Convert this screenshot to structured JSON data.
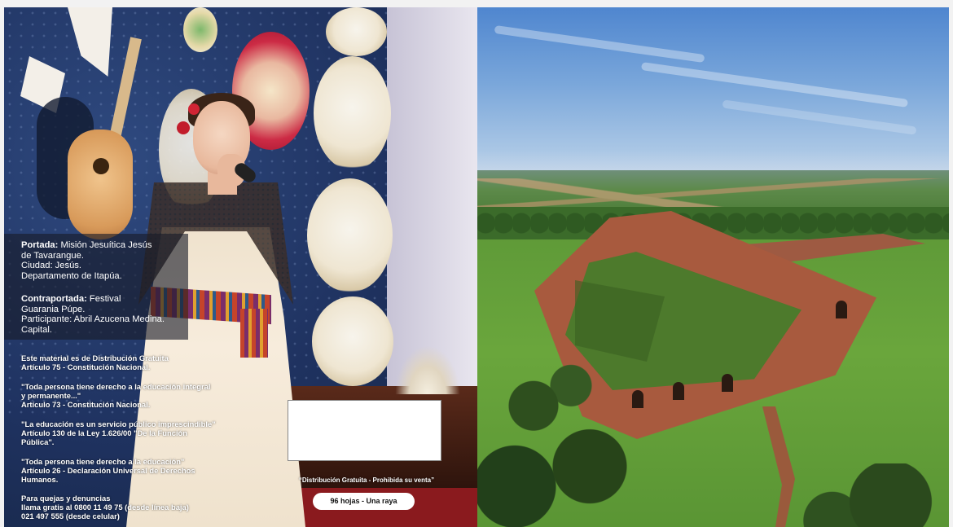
{
  "back_cover": {
    "caption": {
      "portada_label": "Portada:",
      "portada_text_1": "Misión Jesuítica Jesús",
      "portada_text_2": "de Tavarangue.",
      "portada_text_3": "Ciudad: Jesús.",
      "portada_text_4": "Departamento de Itapúa.",
      "contra_label": "Contraportada:",
      "contra_text_1": "Festival",
      "contra_text_2": "Guarania Púpe.",
      "contra_text_3": "Participante: Abril Azucena Medina.",
      "contra_text_4": "Capital."
    },
    "legal": {
      "l1a": "Este material es de Distribución Gratuita",
      "l1b": "Artículo 75 - Constitución Nacional.",
      "l2a": "\"Toda persona tiene derecho a la educación integral",
      "l2b": "y permanente...\"",
      "l2c": "Artículo 73 - Constitución Nacional.",
      "l3a": "\"La educación es un servicio público imprescindible\"",
      "l3b": "Artículo 130 de la Ley 1.626/00 \"De la Función",
      "l3c": "Pública\".",
      "l4a": "\"Toda persona tiene derecho a la educación\"",
      "l4b": "Artículo 26 - Declaración Universal de Derechos",
      "l4c": "Humanos.",
      "l5a": "Para quejas y denuncias",
      "l5b": "llama gratis al 0800 11 49 75 (desde línea baja)",
      "l5c": "021 497 555 (desde celular)"
    },
    "distribution_note": "“Distribución Gratuita - Prohibida su venta”",
    "pages_pill": "96 hojas - Una raya"
  }
}
